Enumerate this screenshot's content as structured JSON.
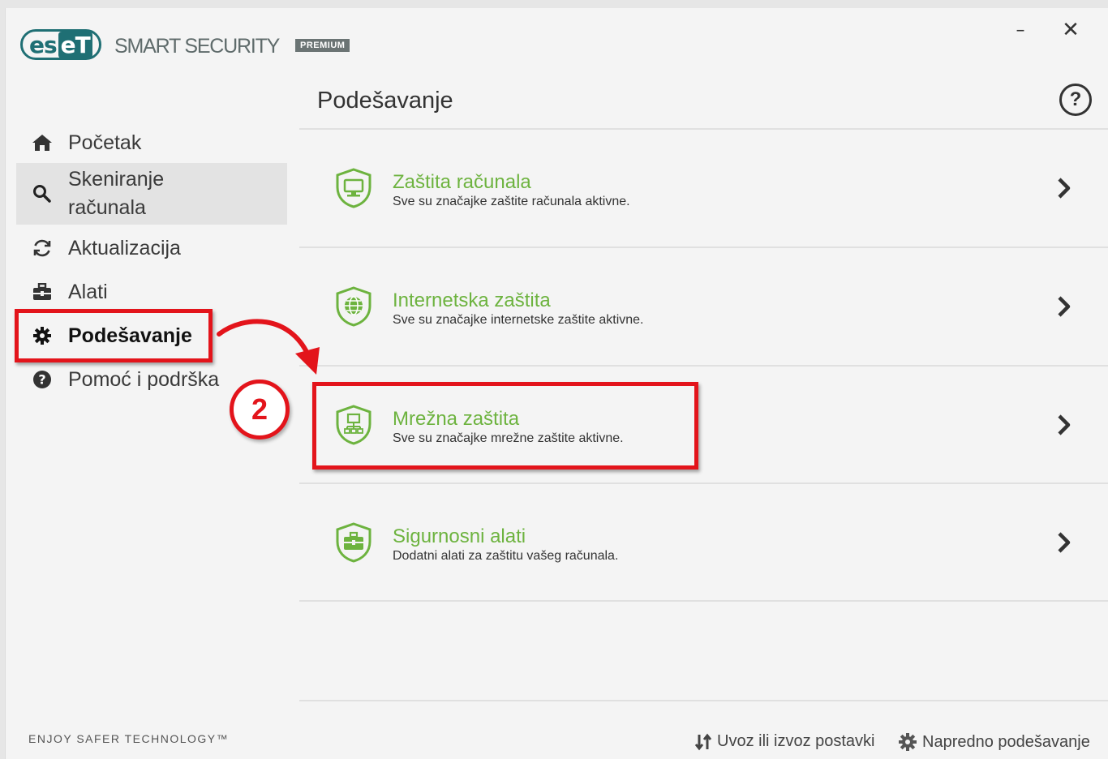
{
  "app": {
    "logo_left": "es",
    "logo_right": "eT",
    "product_name": "SMART SECURITY",
    "edition_badge": "PREMIUM",
    "minimize_glyph": "–",
    "close_glyph": "✕"
  },
  "sidebar": {
    "items": [
      {
        "label": "Početak",
        "icon": "home-icon"
      },
      {
        "label": "Skeniranje\nračunala",
        "icon": "search-icon"
      },
      {
        "label": "Aktualizacija",
        "icon": "refresh-icon"
      },
      {
        "label": "Alati",
        "icon": "toolbox-icon"
      },
      {
        "label": "Podešavanje",
        "icon": "gear-icon",
        "active": true
      },
      {
        "label": "Pomoć i podrška",
        "icon": "question-icon"
      }
    ],
    "tagline": "ENJOY SAFER TECHNOLOGY™"
  },
  "main": {
    "title": "Podešavanje",
    "help_glyph": "?",
    "rows": [
      {
        "title": "Zaštita računala",
        "desc": "Sve su značajke zaštite računala aktivne.",
        "icon": "shield-computer-icon"
      },
      {
        "title": "Internetska zaštita",
        "desc": "Sve su značajke internetske zaštite aktivne.",
        "icon": "shield-globe-icon"
      },
      {
        "title": "Mrežna zaštita",
        "desc": "Sve su značajke mrežne zaštite aktivne.",
        "icon": "shield-network-icon"
      },
      {
        "title": "Sigurnosni alati",
        "desc": "Dodatni alati za zaštitu vašeg računala.",
        "icon": "shield-toolbox-icon"
      }
    ]
  },
  "footer": {
    "import_export": "Uvoz ili izvoz postavki",
    "advanced": "Napredno podešavanje"
  },
  "annotation": {
    "step_number": "2"
  },
  "colors": {
    "accent_green": "#6db33f",
    "brand_teal": "#1f6f74",
    "annotation_red": "#e3141b"
  }
}
